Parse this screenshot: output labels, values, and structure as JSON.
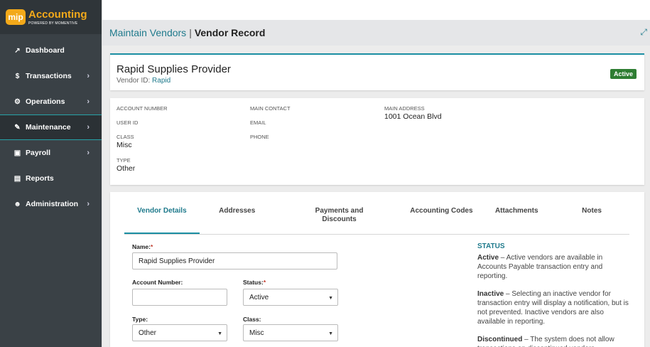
{
  "brand": {
    "badge": "mip",
    "title": "Accounting",
    "subtitle": "POWERED BY MOMENTIVE",
    "accent": "#f3a91a"
  },
  "sidebar": {
    "items": [
      {
        "label": "Dashboard",
        "icon": "chart-line-icon",
        "glyph": "↗",
        "chevron": ""
      },
      {
        "label": "Transactions",
        "icon": "dollar-icon",
        "glyph": "$",
        "chevron": "›"
      },
      {
        "label": "Operations",
        "icon": "gears-icon",
        "glyph": "⚙",
        "chevron": "›"
      },
      {
        "label": "Maintenance",
        "icon": "wrench-icon",
        "glyph": "✎",
        "chevron": "›"
      },
      {
        "label": "Payroll",
        "icon": "money-icon",
        "glyph": "▣",
        "chevron": "›"
      },
      {
        "label": "Reports",
        "icon": "document-icon",
        "glyph": "▤",
        "chevron": ""
      },
      {
        "label": "Administration",
        "icon": "users-icon",
        "glyph": "☻",
        "chevron": "›"
      }
    ]
  },
  "header": {
    "crumb_link": "Maintain Vendors",
    "separator": "|",
    "current": "Vendor Record",
    "expand_glyph": "⤢"
  },
  "vendor": {
    "name": "Rapid Supplies Provider",
    "id_label": "Vendor ID:",
    "id_value": "Rapid",
    "status_badge": "Active"
  },
  "info": {
    "account_number_label": "ACCOUNT NUMBER",
    "user_id_label": "USER ID",
    "class_label": "CLASS",
    "class_value": "Misc",
    "type_label": "TYPE",
    "type_value": "Other",
    "main_contact_label": "MAIN CONTACT",
    "email_label": "EMAIL",
    "phone_label": "PHONE",
    "main_address_label": "MAIN ADDRESS",
    "main_address_value": "1001 Ocean Blvd"
  },
  "tabs": [
    "Vendor Details",
    "Addresses",
    "Payments and Discounts",
    "Accounting Codes",
    "Attachments",
    "Notes"
  ],
  "form": {
    "name_label": "Name:",
    "name_value": "Rapid Supplies Provider",
    "account_number_label": "Account Number:",
    "account_number_value": "",
    "status_label": "Status:",
    "status_value": "Active",
    "type_label": "Type:",
    "type_value": "Other",
    "class_label": "Class:",
    "class_value": "Misc",
    "required_mark": "*",
    "caret": "▼"
  },
  "status_help": {
    "title": "STATUS",
    "active_term": "Active",
    "active_text": " – Active vendors are available in Accounts Payable transaction entry and reporting.",
    "inactive_term": "Inactive",
    "inactive_text": " – Selecting an inactive vendor for transaction entry will display a notification, but is not prevented. Inactive vendors are also available in reporting.",
    "discontinued_term": "Discontinued",
    "discontinued_text": " – The system does not allow transactions on discontinued vendors."
  }
}
